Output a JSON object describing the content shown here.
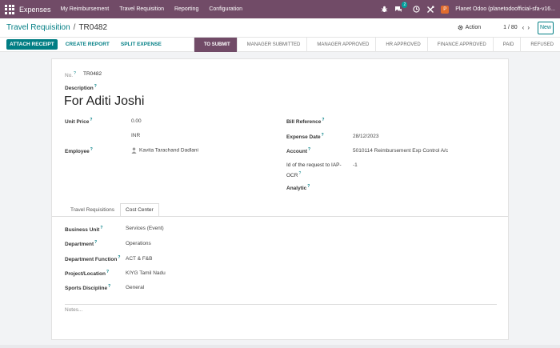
{
  "navbar": {
    "brand": "Expenses",
    "menu": [
      "My Reimbursement",
      "Travel Requisition",
      "Reporting",
      "Configuration"
    ],
    "chat_badge": "2",
    "user_initial": "P",
    "user_name": "Planet Odoo (planetodoofficial-sfa-v16..."
  },
  "control": {
    "breadcrumb_parent": "Travel Requisition",
    "breadcrumb_sep": "/",
    "breadcrumb_current": "TR0482",
    "action_label": "Action",
    "pager": "1 / 80",
    "new_label": "New"
  },
  "statusbar": {
    "buttons": [
      "ATTACH RECEIPT",
      "CREATE REPORT",
      "SPLIT EXPENSE"
    ],
    "stages": [
      "TO SUBMIT",
      "MANAGER SUBMITTED",
      "MANAGER APPROVED",
      "HR APPROVED",
      "FINANCE APPROVED",
      "PAID",
      "REFUSED"
    ],
    "active_stage": "TO SUBMIT"
  },
  "form": {
    "no_label": "No.",
    "no_value": "TR0482",
    "description_label": "Description",
    "description_value": "For Aditi Joshi",
    "unit_price_label": "Unit Price",
    "unit_price_value": "0.00",
    "currency": "INR",
    "employee_label": "Employee",
    "employee_value": "Kavita Tarachand Dadlani",
    "bill_ref_label": "Bill Reference",
    "expense_date_label": "Expense Date",
    "expense_date_value": "28/12/2023",
    "account_label": "Account",
    "account_value": "5010114 Reimbursement Exp Control A/c",
    "iap_label_1": "Id of the request to IAP-",
    "iap_label_2": "OCR",
    "iap_value": "-1",
    "analytic_label": "Analytic"
  },
  "tabs": [
    "Travel Requisitions",
    "Cost Center"
  ],
  "cost_center": {
    "business_unit_label": "Business Unit",
    "business_unit_value": "Services (Event)",
    "department_label": "Department",
    "department_value": "Operations",
    "dept_function_label": "Department Function",
    "dept_function_value": "ACT & F&B",
    "project_label": "Project/Location",
    "project_value": "KIYG Tamil Nadu",
    "sports_label": "Sports Discipline",
    "sports_value": "General"
  },
  "notes_placeholder": "Notes...",
  "colors": {
    "brand": "#714b67",
    "accent": "#017e84"
  }
}
